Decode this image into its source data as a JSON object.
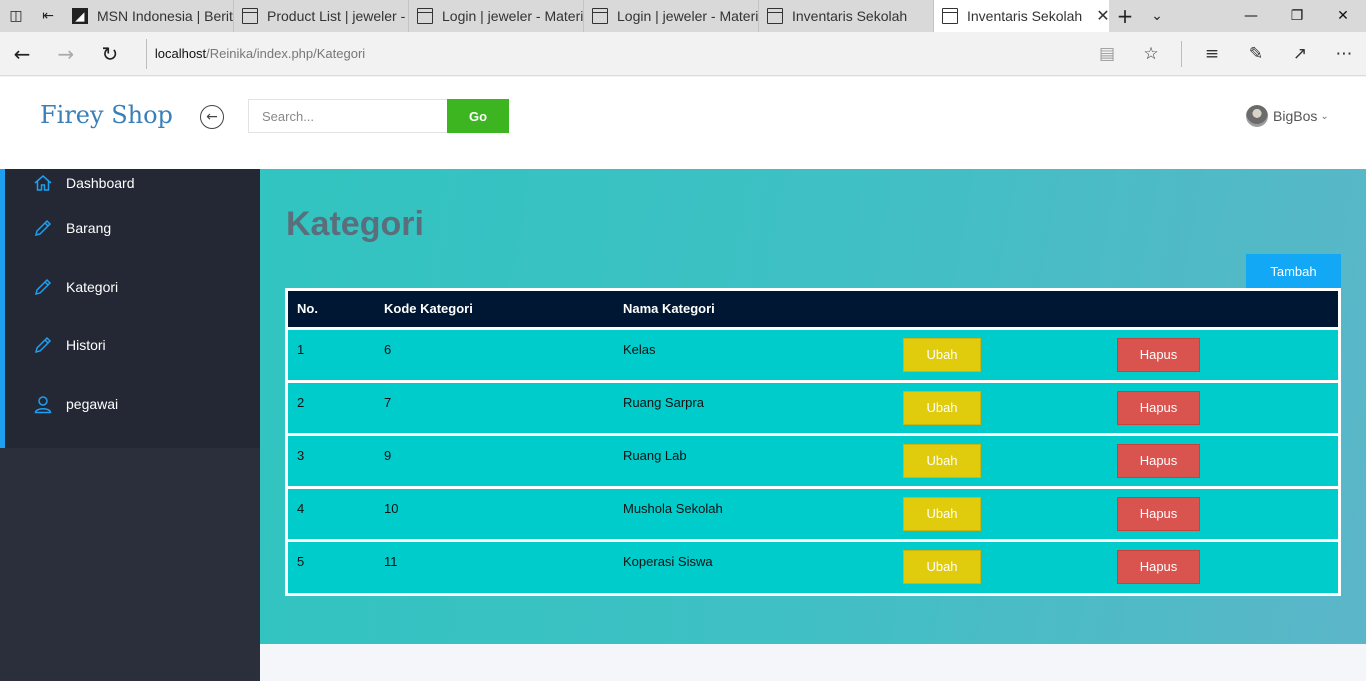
{
  "browser": {
    "tabs": [
      {
        "title": "MSN Indonesia | Berita",
        "icon": "msn-icon"
      },
      {
        "title": "Product List | jeweler - I",
        "icon": "page-icon"
      },
      {
        "title": "Login | jeweler - Materi",
        "icon": "page-icon"
      },
      {
        "title": "Login | jeweler - Materi",
        "icon": "page-icon"
      },
      {
        "title": "Inventaris Sekolah",
        "icon": "page-icon"
      },
      {
        "title": "Inventaris Sekolah",
        "icon": "page-icon",
        "active": true
      }
    ],
    "url_host": "localhost",
    "url_path": "/Reinika/index.php/Kategori"
  },
  "header": {
    "brand": "Firey Shop",
    "search_placeholder": "Search...",
    "go_label": "Go",
    "username": "BigBos"
  },
  "sidebar": {
    "items": [
      {
        "label": "Dashboard",
        "icon": "home-icon"
      },
      {
        "label": "Barang",
        "icon": "pencil-icon"
      },
      {
        "label": "Kategori",
        "icon": "pencil-icon"
      },
      {
        "label": "Histori",
        "icon": "pencil-icon"
      },
      {
        "label": "pegawai",
        "icon": "user-icon"
      }
    ]
  },
  "main": {
    "title": "Kategori",
    "add_label": "Tambah",
    "table": {
      "headers": [
        "No.",
        "Kode Kategori",
        "Nama Kategori"
      ],
      "edit_label": "Ubah",
      "delete_label": "Hapus",
      "rows": [
        {
          "no": "1",
          "kode": "6",
          "nama": "Kelas"
        },
        {
          "no": "2",
          "kode": "7",
          "nama": "Ruang Sarpra"
        },
        {
          "no": "3",
          "kode": "9",
          "nama": "Ruang Lab"
        },
        {
          "no": "4",
          "kode": "10",
          "nama": "Mushola Sekolah"
        },
        {
          "no": "5",
          "kode": "11",
          "nama": "Koperasi Siswa"
        }
      ]
    }
  },
  "colors": {
    "brand": "#3a7fb9",
    "go": "#3cb521",
    "tambah": "#13a8f5",
    "ubah": "#e0cb0d",
    "hapus": "#d9534f",
    "table_header": "#001733",
    "row": "#00cccc",
    "sidebar": "#232834"
  }
}
